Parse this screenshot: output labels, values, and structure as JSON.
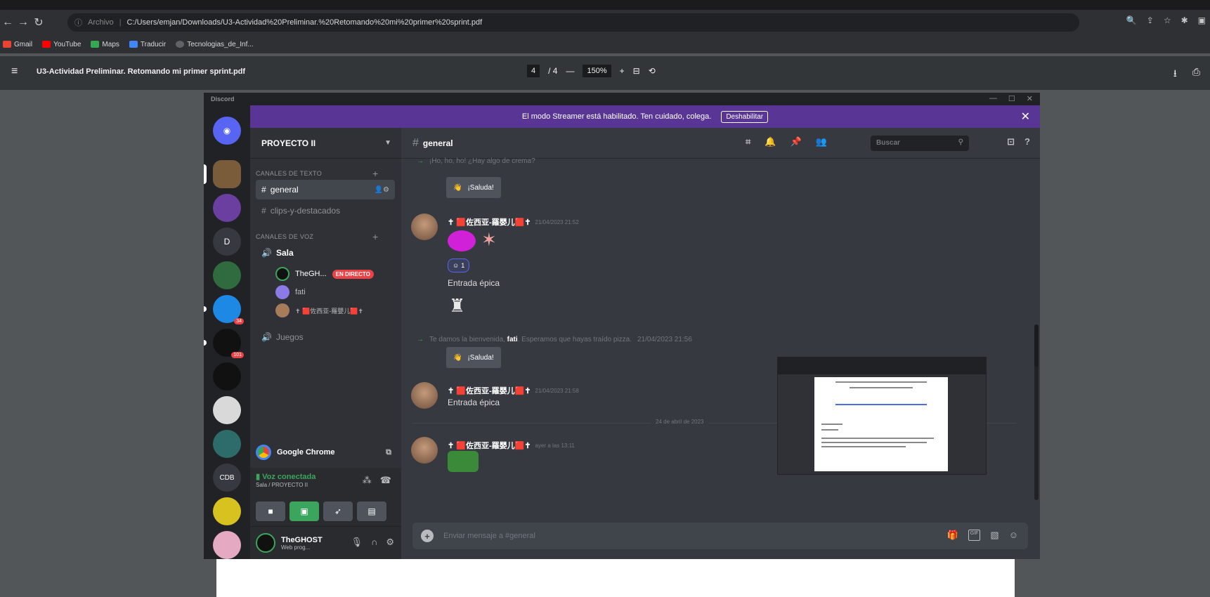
{
  "browser": {
    "url_prefix": "Archivo",
    "url": "C:/Users/emjan/Downloads/U3-Actividad%20Preliminar.%20Retomando%20mi%20primer%20sprint.pdf",
    "bookmarks": [
      {
        "label": "Gmail",
        "color": "#ea4335"
      },
      {
        "label": "YouTube",
        "color": "#ff0000"
      },
      {
        "label": "Maps",
        "color": "#34a853"
      },
      {
        "label": "Traducir",
        "color": "#4285f4"
      },
      {
        "label": "Tecnologias_de_Inf...",
        "color": "#5f6368"
      }
    ]
  },
  "pdf": {
    "title": "U3-Actividad Preliminar. Retomando mi primer sprint.pdf",
    "page": "4",
    "page_total": "/ 4",
    "zoom": "150%"
  },
  "discord": {
    "window_title": "Discord",
    "banner_text": "El modo Streamer está habilitado. Ten cuidado, colega.",
    "banner_button": "Deshabilitar",
    "servers": [
      {
        "initial": "",
        "color": "#5865f2",
        "icon": "discord-home-icon"
      },
      {
        "initial": "",
        "color": "#7a5c3a"
      },
      {
        "initial": "",
        "color": "#6a3fa0"
      },
      {
        "initial": "D",
        "color": "#36393f"
      },
      {
        "initial": "",
        "color": "#2f6b3f"
      },
      {
        "initial": "",
        "color": "#1e88e5",
        "badge": "34"
      },
      {
        "initial": "",
        "color": "#111111",
        "badge": "101"
      },
      {
        "initial": "",
        "color": "#111111"
      },
      {
        "initial": "",
        "color": "#d9d9d9"
      },
      {
        "initial": "",
        "color": "#2e6b6b"
      },
      {
        "initial": "CDB",
        "color": "#36393f"
      },
      {
        "initial": "",
        "color": "#d8c21f"
      }
    ],
    "guild_name": "PROYECTO II",
    "categories": {
      "text": "CANALES DE TEXTO",
      "voice": "CANALES DE VOZ"
    },
    "text_channels": [
      "general",
      "clips-y-destacados"
    ],
    "voice_channels": [
      "Sala",
      "Juegos"
    ],
    "voice_users": [
      {
        "name": "TheGH...",
        "live": "EN DIRECTO"
      },
      {
        "name": "fati",
        "live": ""
      },
      {
        "name": "✝ 🟥佐西亚-羅嬰儿🟥✝",
        "live": ""
      }
    ],
    "activity_app": "Google Chrome",
    "voice_status": "Voz conectada",
    "voice_sub": "Sala / PROYECTO II",
    "user": {
      "name": "TheGHOST",
      "status": "Web prog..."
    },
    "channel_name": "general",
    "search_placeholder": "Buscar",
    "composer_placeholder": "Enviar mensaje a #general",
    "wave_label": "¡Saluda!",
    "messages": {
      "sys1": "¡Ho, ho, ho! ¿Hay algo de crema?",
      "author": "✝ 🟥佐西亚-羅嬰儿🟥✝",
      "ts1": "21/04/2023 21:52",
      "reaction_count": "1",
      "text1": "Entrada épica",
      "sys2_pre": "Te damos la bienvenida,",
      "sys2_user": "fati",
      "sys2_post": ". Esperamos que hayas traído pizza.",
      "ts_sys2": "21/04/2023 21:56",
      "ts2": "21/04/2023 21:58",
      "text2": "Entrada épica",
      "divider": "24 de abril de 2023",
      "ts3": "ayer a las 13:11"
    }
  }
}
